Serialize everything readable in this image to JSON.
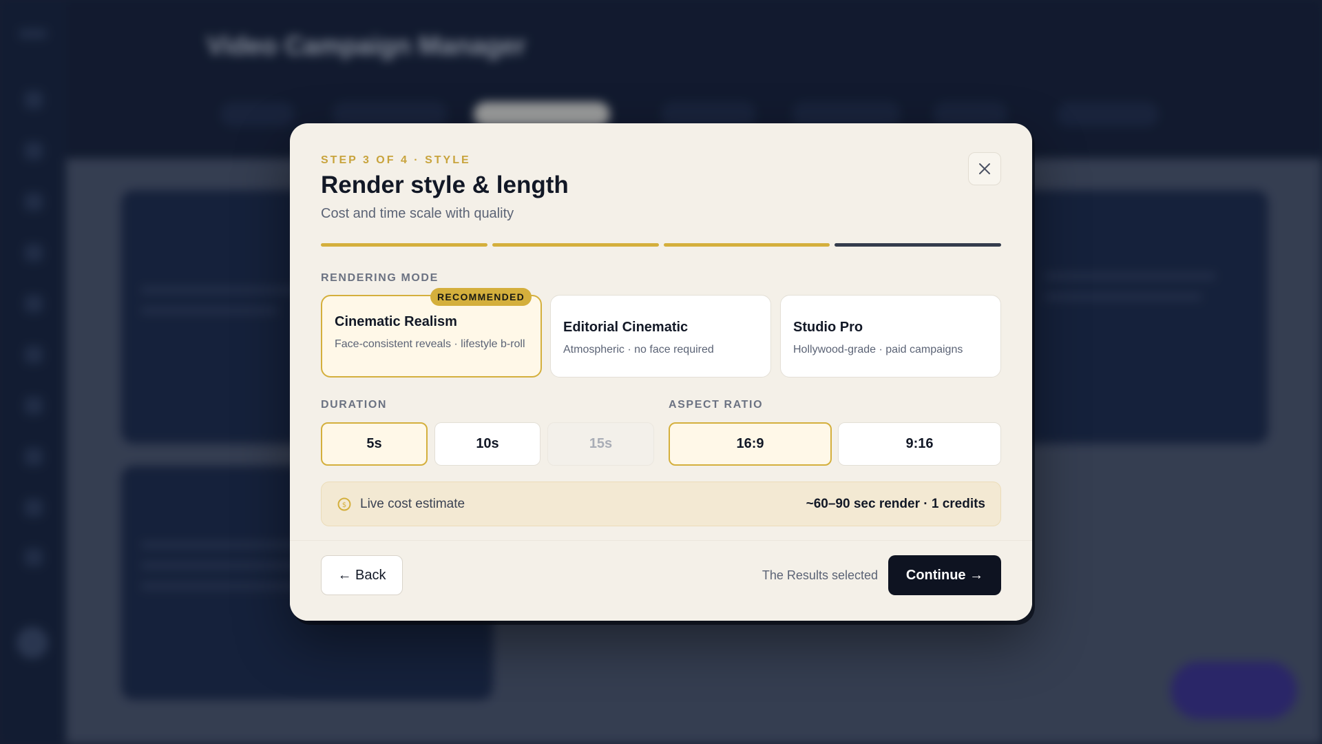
{
  "background": {
    "app_title": "Video Campaign Manager",
    "app_subtitle": "",
    "tabs": [
      "",
      "",
      "",
      "",
      "",
      "",
      ""
    ],
    "cards": [
      "",
      ""
    ]
  },
  "modal": {
    "step_label": "STEP 3 OF 4 · STYLE",
    "title": "Render style & length",
    "subtitle": "Cost and time scale with quality",
    "progress": {
      "total_steps": 4,
      "current_step": 3
    },
    "rendering_mode": {
      "label": "RENDERING MODE",
      "options": [
        {
          "title": "Cinematic Realism",
          "description": "Face-consistent reveals · lifestyle b-roll",
          "badge": "RECOMMENDED",
          "selected": true
        },
        {
          "title": "Editorial Cinematic",
          "description": "Atmospheric · no face required",
          "selected": false
        },
        {
          "title": "Studio Pro",
          "description": "Hollywood-grade · paid campaigns",
          "selected": false
        }
      ]
    },
    "duration": {
      "label": "DURATION",
      "options": [
        {
          "value": "5s",
          "selected": true
        },
        {
          "value": "10s",
          "selected": false
        },
        {
          "value": "15s",
          "selected": false,
          "disabled": true
        }
      ]
    },
    "aspect_ratio": {
      "label": "ASPECT RATIO",
      "options": [
        {
          "value": "16:9",
          "selected": true
        },
        {
          "value": "9:16",
          "selected": false
        }
      ]
    },
    "cost": {
      "label": "Live cost estimate",
      "value": "~60–90 sec render · 1 credits"
    },
    "footer": {
      "back_label": "← Back",
      "status": "The Results selected",
      "continue_label": "Continue →"
    }
  },
  "colors": {
    "accent": "#d4af3c",
    "modal_bg": "#f4f0e8",
    "primary_button": "#0e1321",
    "overlay": "#1a2238"
  },
  "icons": [
    "close-icon",
    "coin-icon"
  ]
}
